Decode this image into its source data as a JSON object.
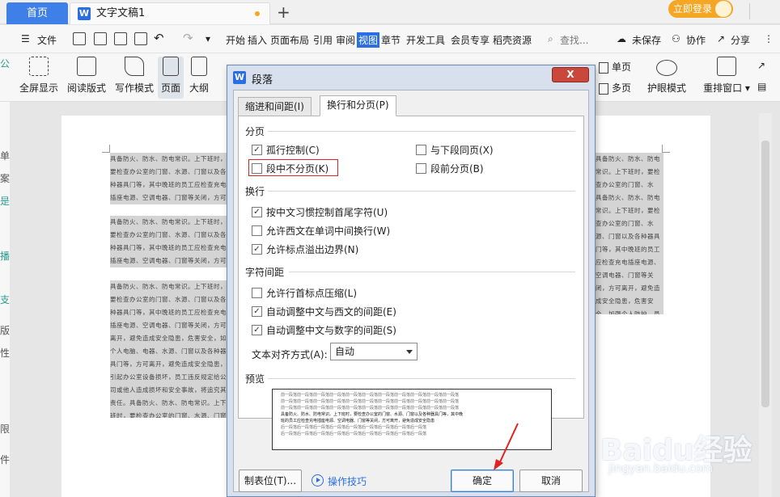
{
  "titlebar": {
    "home_tab": "首页",
    "doc_tab": "文字文稿1",
    "login": "立即登录"
  },
  "menubar": {
    "file": "文件",
    "items": [
      "开始",
      "插入",
      "页面布局",
      "引用",
      "审阅",
      "视图",
      "章节",
      "开发工具",
      "会员专享",
      "稻壳资源"
    ],
    "search": "查找...",
    "unsaved": "未保存",
    "collab": "协作",
    "share": "分享"
  },
  "ribbon": {
    "fullscreen": "全屏显示",
    "reading": "阅读版式",
    "writing": "写作模式",
    "page": "页面",
    "outline": "大纲",
    "single_page": "单页",
    "multi_page": "多页",
    "eye_protect": "护眼模式",
    "rearrange": "重排窗口"
  },
  "leftstrip": [
    "公",
    "单",
    "案",
    "是",
    "播",
    "支",
    "版",
    "性",
    "限",
    "件"
  ],
  "document": {
    "para1": "具备防火、防水、防电常识。上下班时，要检查办公室的门窗、水源、门窗以及各种器具门等，其中晚班的员工应检查充电插座电源、空调电器、门窗等关闭，方可离开，避免造成安全隐患，危害安全，加强个人防护，共同营造安全的工作环境，员工违反规定给公司或他人造成损坏和安全事故，将追究其责任。",
    "para2": "具备防火、防水、防电常识。上下班时，要检查办公室的门窗、水源、门窗以及各种器具门等，其中晚班的员工应检查充电插座电源、空调电器、门窗等关闭，方可离开，避免造成安全隐患，危害安全，加强个人防护，员工违反规定给公司或他人造成损坏和安全事故，将追究其责任。",
    "para3": "具备防火、防水、防电常识。上下班时，要检查办公室的门窗、水源、门窗以及各种器具门等，其中晚班的员工应检查充电插座电源、空调电器、门窗等关闭，方可离开，避免造成安全隐患，危害安全，如个人电脑、电器、水源、门窗以及各种器具门等，方可离开，避免造成安全隐患，引起办公室设备损坏，员工违反规定给公司或他人造成损坏和安全事故，将追究其责任。具备防火、防水、防电常识。上下班时，要检查办公室的门窗、水源、门窗以及各种器具门等，安全隐患，危害安全，如个人电脑、防水，将追究其责任。具备防火、防水、防电常识。"
  },
  "dialog": {
    "title": "段落",
    "close": "X",
    "tabs": [
      "缩进和间距(I)",
      "换行和分页(P)"
    ],
    "sections": {
      "pagination": "分页",
      "line_break": "换行",
      "char_spacing": "字符间距",
      "preview": "预览"
    },
    "options": {
      "widow_control": {
        "label": "孤行控制(C)",
        "checked": true
      },
      "keep_with_next": {
        "label": "与下段同页(X)",
        "checked": false
      },
      "keep_lines": {
        "label": "段中不分页(K)",
        "checked": false
      },
      "page_break_before": {
        "label": "段前分页(B)",
        "checked": false
      },
      "chinese_rules": {
        "label": "按中文习惯控制首尾字符(U)",
        "checked": true
      },
      "word_wrap": {
        "label": "允许西文在单词中间换行(W)",
        "checked": false
      },
      "hanging_punct": {
        "label": "允许标点溢出边界(N)",
        "checked": true
      },
      "compress_punct": {
        "label": "允许行首标点压缩(L)",
        "checked": false
      },
      "auto_space_en": {
        "label": "自动调整中文与西文的间距(E)",
        "checked": true
      },
      "auto_space_num": {
        "label": "自动调整中文与数字的间距(S)",
        "checked": true
      }
    },
    "align_label": "文本对齐方式(A):",
    "align_value": "自动",
    "preview_text": {
      "prev": "前一段落前一段落前一段落前一段落前一段落前一段落前一段落前一段落前一段落前一段落前一段落",
      "sample1": "具备防火、防水、防电常识。上下班时，要检查办公室的门窗、水源、门窗以及各种器具门等，其中晚",
      "sample2": "班的员工应检查充电插座电源、空调电器、门窗等关闭，方可离开，避免造成安全隐患",
      "next": "后一段落后一段落后一段落后一段落后一段落后一段落后一段落后一段落后一段落"
    },
    "buttons": {
      "tabs": "制表位(T)...",
      "tips": "操作技巧",
      "ok": "确定",
      "cancel": "取消"
    }
  },
  "watermark": {
    "brand": "Baidu经验",
    "url": "jingyan.baidu.com"
  },
  "colors": {
    "accent": "#2a6ee3",
    "highlight": "#e02222",
    "login": "#f5a623"
  }
}
